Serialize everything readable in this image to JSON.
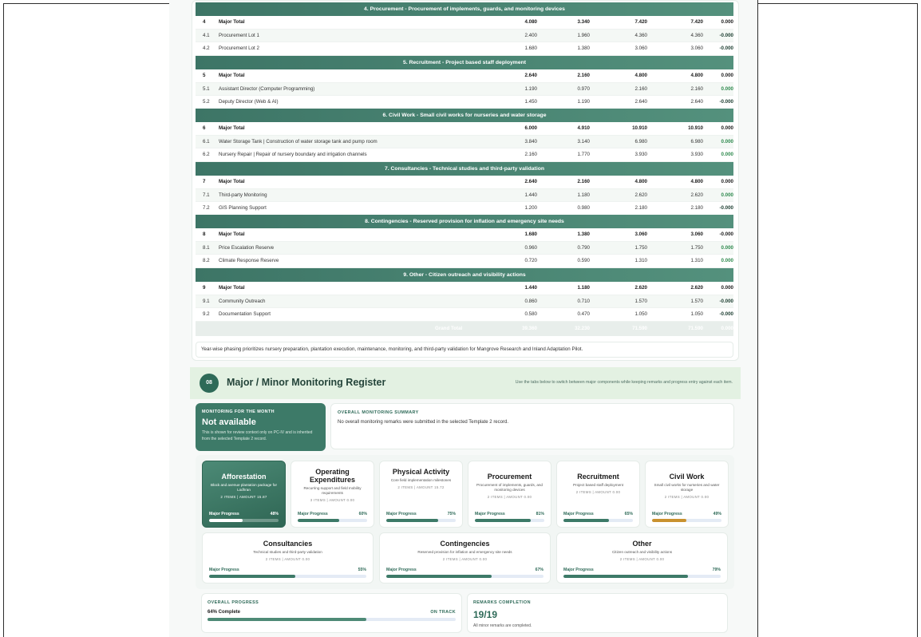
{
  "table": {
    "sections": [
      {
        "title": "4. Procurement - Procurement of implements, guards, and monitoring devices",
        "rows": [
          {
            "no": "4",
            "item": "Major Total",
            "v1": "4.080",
            "v2": "3.340",
            "v3": "7.420",
            "v4": "7.420",
            "diff": "0.000",
            "bold": true
          },
          {
            "no": "4.1",
            "item": "Procurement Lot 1",
            "v1": "2.400",
            "v2": "1.960",
            "v3": "4.360",
            "v4": "4.360",
            "diff": "-0.000"
          },
          {
            "no": "4.2",
            "item": "Procurement Lot 2",
            "v1": "1.680",
            "v2": "1.380",
            "v3": "3.060",
            "v4": "3.060",
            "diff": "-0.000"
          }
        ]
      },
      {
        "title": "5. Recruitment - Project based staff deployment",
        "rows": [
          {
            "no": "5",
            "item": "Major Total",
            "v1": "2.640",
            "v2": "2.160",
            "v3": "4.800",
            "v4": "4.800",
            "diff": "0.000",
            "bold": true
          },
          {
            "no": "5.1",
            "item": "Assistant Director (Computer Programming)",
            "v1": "1.190",
            "v2": "0.970",
            "v3": "2.160",
            "v4": "2.160",
            "diff": "0.000"
          },
          {
            "no": "5.2",
            "item": "Deputy Director (Web & AI)",
            "v1": "1.450",
            "v2": "1.190",
            "v3": "2.640",
            "v4": "2.640",
            "diff": "-0.000"
          }
        ]
      },
      {
        "title": "6. Civil Work - Small civil works for nurseries and water storage",
        "rows": [
          {
            "no": "6",
            "item": "Major Total",
            "v1": "6.000",
            "v2": "4.910",
            "v3": "10.910",
            "v4": "10.910",
            "diff": "0.000",
            "bold": true
          },
          {
            "no": "6.1",
            "item": "Water Storage Tank | Construction of water storage tank and pump room",
            "v1": "3.840",
            "v2": "3.140",
            "v3": "6.980",
            "v4": "6.980",
            "diff": "0.000"
          },
          {
            "no": "6.2",
            "item": "Nursery Repair | Repair of nursery boundary and irrigation channels",
            "v1": "2.160",
            "v2": "1.770",
            "v3": "3.930",
            "v4": "3.930",
            "diff": "0.000"
          }
        ]
      },
      {
        "title": "7. Consultancies - Technical studies and third-party validation",
        "rows": [
          {
            "no": "7",
            "item": "Major Total",
            "v1": "2.640",
            "v2": "2.160",
            "v3": "4.800",
            "v4": "4.800",
            "diff": "0.000",
            "bold": true
          },
          {
            "no": "7.1",
            "item": "Third-party Monitoring",
            "v1": "1.440",
            "v2": "1.180",
            "v3": "2.620",
            "v4": "2.620",
            "diff": "0.000"
          },
          {
            "no": "7.2",
            "item": "GIS Planning Support",
            "v1": "1.200",
            "v2": "0.980",
            "v3": "2.180",
            "v4": "2.180",
            "diff": "-0.000"
          }
        ]
      },
      {
        "title": "8. Contingencies - Reserved provision for inflation and emergency site needs",
        "rows": [
          {
            "no": "8",
            "item": "Major Total",
            "v1": "1.680",
            "v2": "1.380",
            "v3": "3.060",
            "v4": "3.060",
            "diff": "-0.000",
            "bold": true
          },
          {
            "no": "8.1",
            "item": "Price Escalation Reserve",
            "v1": "0.960",
            "v2": "0.790",
            "v3": "1.750",
            "v4": "1.750",
            "diff": "0.000"
          },
          {
            "no": "8.2",
            "item": "Climate Response Reserve",
            "v1": "0.720",
            "v2": "0.590",
            "v3": "1.310",
            "v4": "1.310",
            "diff": "0.000"
          }
        ]
      },
      {
        "title": "9. Other - Citizen outreach and visibility actions",
        "rows": [
          {
            "no": "9",
            "item": "Major Total",
            "v1": "1.440",
            "v2": "1.180",
            "v3": "2.620",
            "v4": "2.620",
            "diff": "0.000",
            "bold": true
          },
          {
            "no": "9.1",
            "item": "Community Outreach",
            "v1": "0.860",
            "v2": "0.710",
            "v3": "1.570",
            "v4": "1.570",
            "diff": "-0.000"
          },
          {
            "no": "9.2",
            "item": "Documentation Support",
            "v1": "0.580",
            "v2": "0.470",
            "v3": "1.050",
            "v4": "1.050",
            "diff": "-0.000"
          }
        ]
      }
    ],
    "grand_total": {
      "label": "Grand Total",
      "v1": "39.360",
      "v2": "32.230",
      "v3": "71.590",
      "v4": "71.590",
      "diff": "0.000"
    },
    "note": "Year-wise phasing prioritizes nursery preparation, plantation execution, maintenance, monitoring, and third-party validation for Mangrove Research and Inland Adaptation Pilot."
  },
  "register": {
    "number": "08",
    "title": "Major / Minor Monitoring Register",
    "hint": "Use the tabs below to switch between major components while keeping remarks and progress entry against each item.",
    "monitoring": {
      "label": "MONITORING FOR THE MONTH",
      "value": "Not available",
      "sub": "This is shown for review context only on PC-IV and is inherited from the selected Template 2 record."
    },
    "summary": {
      "label": "OVERALL MONITORING SUMMARY",
      "text": "No overall monitoring remarks were submitted in the selected Template 2 record."
    },
    "progress_label": "Major Progress",
    "components": [
      {
        "title": "Afforestation",
        "desc": "Block and avenue plantation package for Lodhran",
        "meta": "2 ITEMS | AMOUNT 15.87",
        "progress": 48,
        "color": "#ffffff",
        "active": true
      },
      {
        "title": "Operating Expenditures",
        "desc": "Recurring support and field mobility requirements",
        "meta": "3 ITEMS | AMOUNT 0.00",
        "progress": 60,
        "color": "#3d7a68"
      },
      {
        "title": "Physical Activity",
        "desc": "Core field implementation milestones",
        "meta": "2 ITEMS | AMOUNT 15.72",
        "progress": 75,
        "color": "#3d7a68"
      },
      {
        "title": "Procurement",
        "desc": "Procurement of implements, guards, and monitoring devices",
        "meta": "2 ITEMS | AMOUNT 0.00",
        "progress": 81,
        "color": "#3d7a68"
      },
      {
        "title": "Recruitment",
        "desc": "Project based staff deployment",
        "meta": "2 ITEMS | AMOUNT 0.00",
        "progress": 65,
        "color": "#3d7a68"
      },
      {
        "title": "Civil Work",
        "desc": "Small civil works for nurseries and water storage",
        "meta": "2 ITEMS | AMOUNT 0.00",
        "progress": 49,
        "color": "#c9922f"
      },
      {
        "title": "Consultancies",
        "desc": "Technical studies and third-party validation",
        "meta": "2 ITEMS | AMOUNT 0.00",
        "progress": 55,
        "color": "#3d7a68"
      },
      {
        "title": "Contingencies",
        "desc": "Reserved provision for inflation and emergency site needs",
        "meta": "2 ITEMS | AMOUNT 0.00",
        "progress": 67,
        "color": "#3d7a68"
      },
      {
        "title": "Other",
        "desc": "Citizen outreach and visibility actions",
        "meta": "2 ITEMS | AMOUNT 0.00",
        "progress": 79,
        "color": "#3d7a68"
      }
    ],
    "overall": {
      "label": "OVERALL PROGRESS",
      "complete": "64% Complete",
      "status": "ON TRACK",
      "progress": 64
    },
    "remarks": {
      "label": "REMARKS COMPLETION",
      "value": "19/19",
      "sub": "All minor remarks are completed."
    }
  }
}
